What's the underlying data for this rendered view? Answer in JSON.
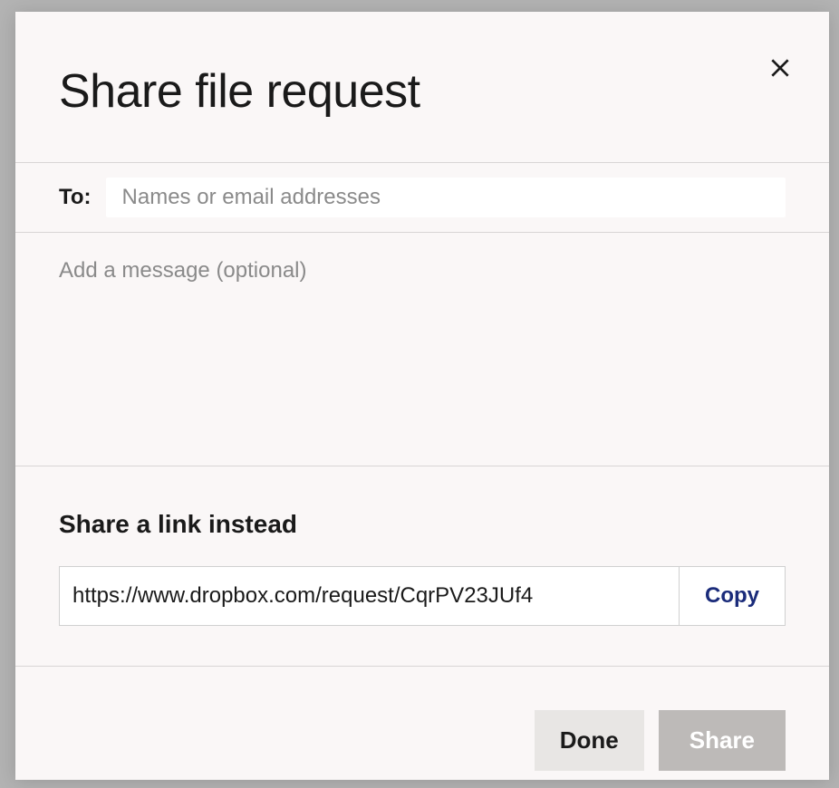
{
  "modal": {
    "title": "Share file request",
    "to_label": "To:",
    "to_placeholder": "Names or email addresses",
    "message_placeholder": "Add a message (optional)"
  },
  "link_section": {
    "heading": "Share a link instead",
    "url": "https://www.dropbox.com/request/CqrPV23JUf4",
    "copy_label": "Copy"
  },
  "footer": {
    "done_label": "Done",
    "share_label": "Share"
  }
}
